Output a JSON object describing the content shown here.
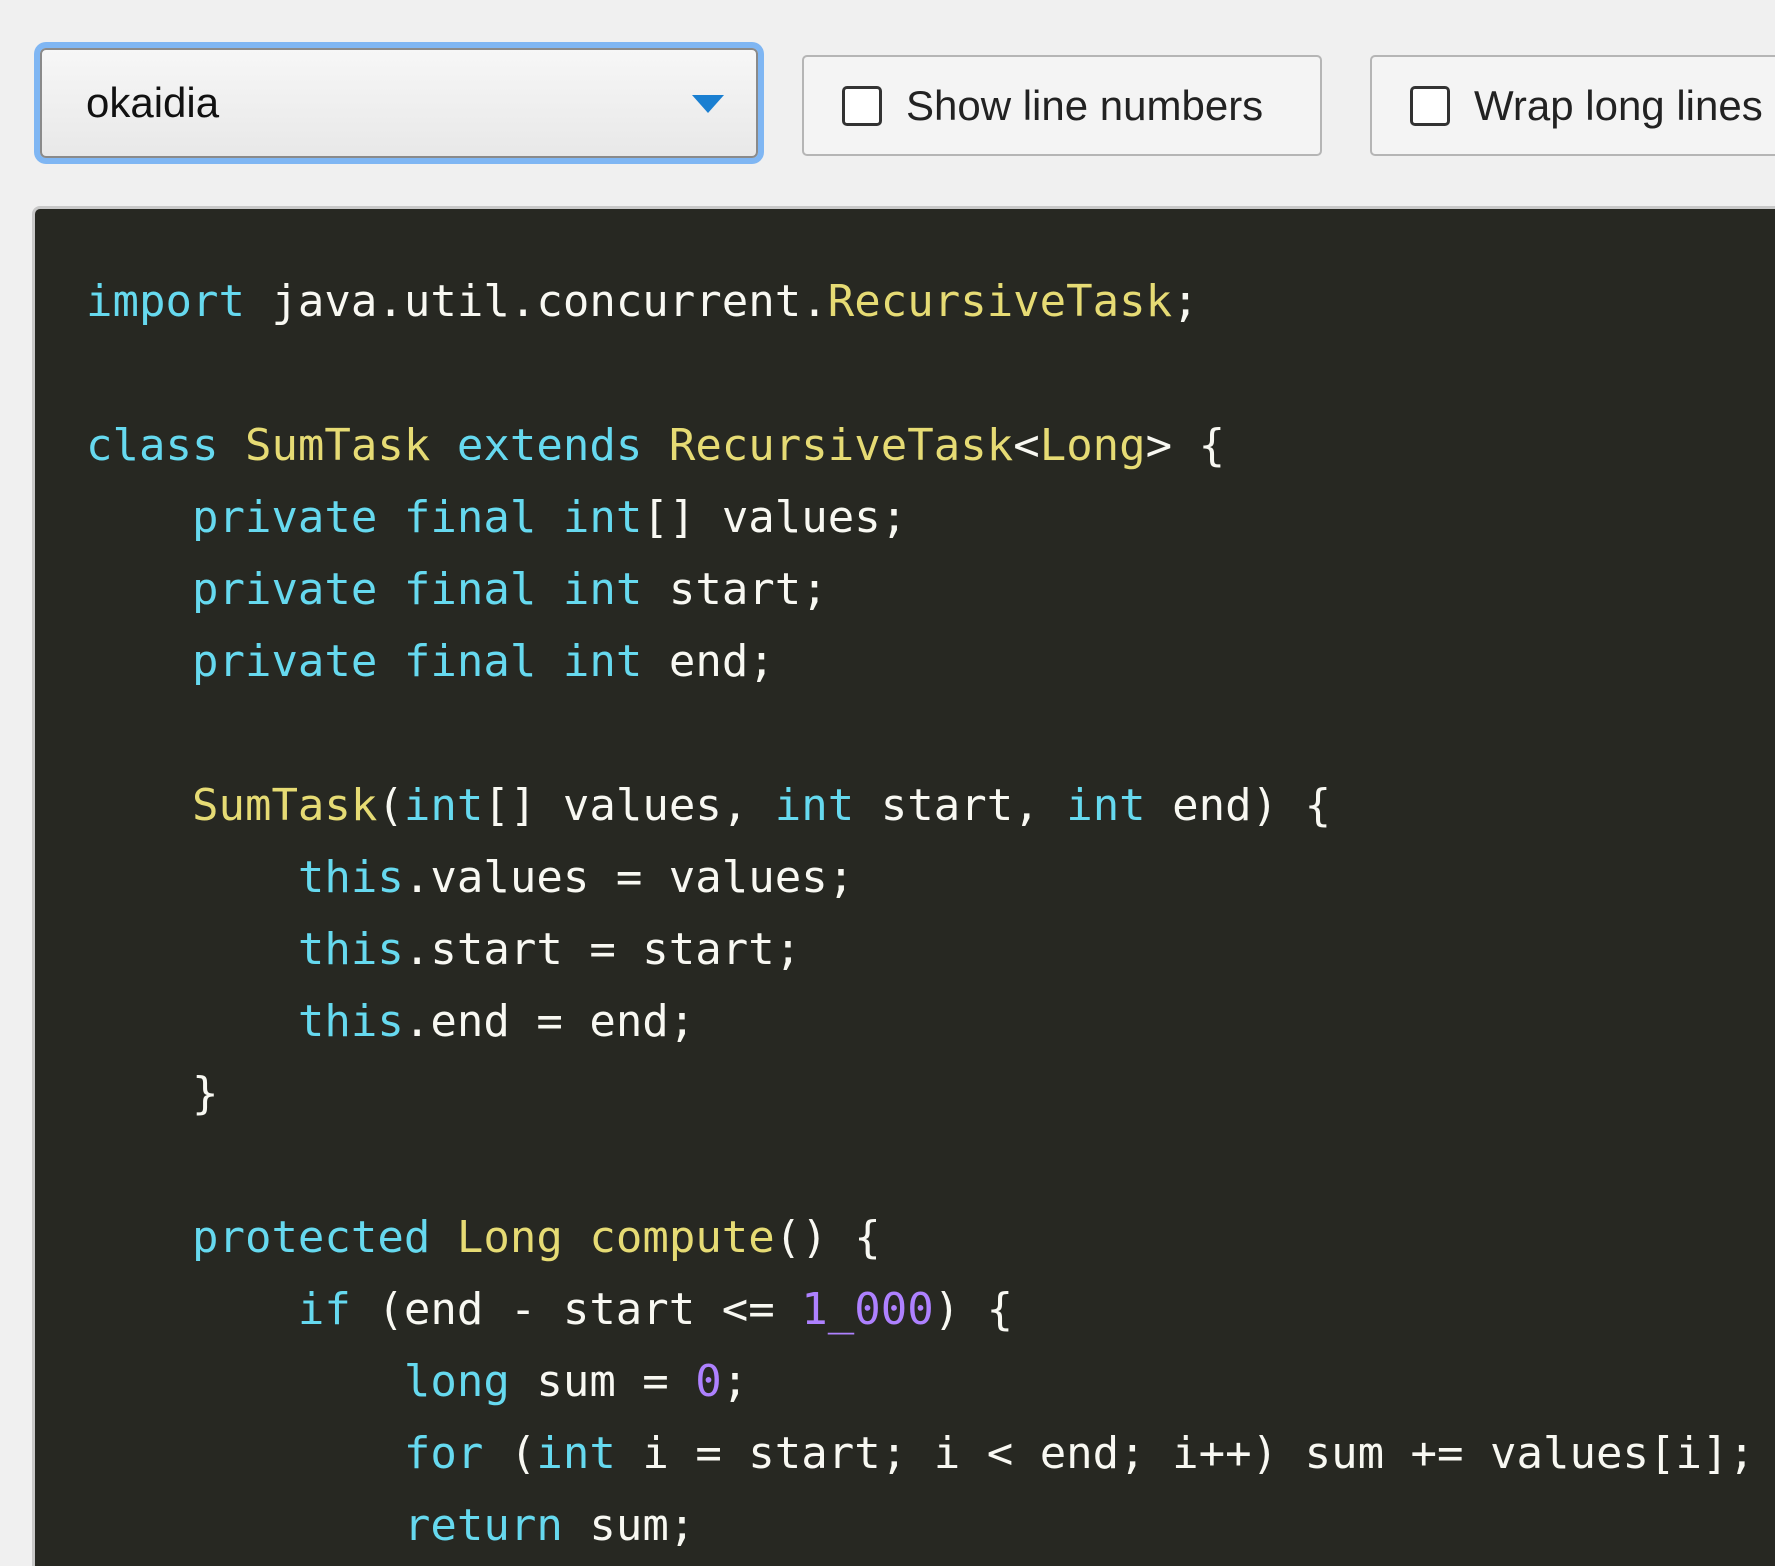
{
  "toolbar": {
    "theme_select": {
      "value": "okaidia"
    },
    "show_line_numbers": {
      "label": "Show line numbers",
      "checked": false
    },
    "wrap_long_lines": {
      "label": "Wrap long lines",
      "checked": false
    }
  },
  "colors": {
    "code_background": "#272822",
    "keyword": "#66d9ef",
    "type_function": "#e6db74",
    "number": "#ae81ff",
    "plain": "#f8f8f2",
    "focus_ring": "#7fb6f3",
    "select_arrow": "#1a7fd1"
  },
  "icons": {
    "select_arrow": "chevron-down-icon",
    "checkbox": "checkbox-unchecked-icon"
  },
  "code": {
    "language": "java",
    "lines": [
      [
        [
          "kw",
          "import"
        ],
        [
          "pl",
          " java.util.concurrent."
        ],
        [
          "ty",
          "RecursiveTask"
        ],
        [
          "pl",
          ";"
        ]
      ],
      [],
      [
        [
          "kw",
          "class"
        ],
        [
          "pl",
          " "
        ],
        [
          "ty",
          "SumTask"
        ],
        [
          "pl",
          " "
        ],
        [
          "kw",
          "extends"
        ],
        [
          "pl",
          " "
        ],
        [
          "ty",
          "RecursiveTask"
        ],
        [
          "pl",
          "<"
        ],
        [
          "ty",
          "Long"
        ],
        [
          "pl",
          "> {"
        ]
      ],
      [
        [
          "pl",
          "    "
        ],
        [
          "kw",
          "private"
        ],
        [
          "pl",
          " "
        ],
        [
          "kw",
          "final"
        ],
        [
          "pl",
          " "
        ],
        [
          "kw",
          "int"
        ],
        [
          "pl",
          "[] values;"
        ]
      ],
      [
        [
          "pl",
          "    "
        ],
        [
          "kw",
          "private"
        ],
        [
          "pl",
          " "
        ],
        [
          "kw",
          "final"
        ],
        [
          "pl",
          " "
        ],
        [
          "kw",
          "int"
        ],
        [
          "pl",
          " start;"
        ]
      ],
      [
        [
          "pl",
          "    "
        ],
        [
          "kw",
          "private"
        ],
        [
          "pl",
          " "
        ],
        [
          "kw",
          "final"
        ],
        [
          "pl",
          " "
        ],
        [
          "kw",
          "int"
        ],
        [
          "pl",
          " end;"
        ]
      ],
      [],
      [
        [
          "pl",
          "    "
        ],
        [
          "fn",
          "SumTask"
        ],
        [
          "pl",
          "("
        ],
        [
          "kw",
          "int"
        ],
        [
          "pl",
          "[] values, "
        ],
        [
          "kw",
          "int"
        ],
        [
          "pl",
          " start, "
        ],
        [
          "kw",
          "int"
        ],
        [
          "pl",
          " end) {"
        ]
      ],
      [
        [
          "pl",
          "        "
        ],
        [
          "kw",
          "this"
        ],
        [
          "pl",
          ".values = values;"
        ]
      ],
      [
        [
          "pl",
          "        "
        ],
        [
          "kw",
          "this"
        ],
        [
          "pl",
          ".start = start;"
        ]
      ],
      [
        [
          "pl",
          "        "
        ],
        [
          "kw",
          "this"
        ],
        [
          "pl",
          ".end = end;"
        ]
      ],
      [
        [
          "pl",
          "    }"
        ]
      ],
      [],
      [
        [
          "pl",
          "    "
        ],
        [
          "kw",
          "protected"
        ],
        [
          "pl",
          " "
        ],
        [
          "ty",
          "Long"
        ],
        [
          "pl",
          " "
        ],
        [
          "fn",
          "compute"
        ],
        [
          "pl",
          "() {"
        ]
      ],
      [
        [
          "pl",
          "        "
        ],
        [
          "kw",
          "if"
        ],
        [
          "pl",
          " (end - start <= "
        ],
        [
          "nu",
          "1_000"
        ],
        [
          "pl",
          ") {"
        ]
      ],
      [
        [
          "pl",
          "            "
        ],
        [
          "kw",
          "long"
        ],
        [
          "pl",
          " sum = "
        ],
        [
          "nu",
          "0"
        ],
        [
          "pl",
          ";"
        ]
      ],
      [
        [
          "pl",
          "            "
        ],
        [
          "kw",
          "for"
        ],
        [
          "pl",
          " ("
        ],
        [
          "kw",
          "int"
        ],
        [
          "pl",
          " i = start; i < end; i++) sum += values[i];"
        ]
      ],
      [
        [
          "pl",
          "            "
        ],
        [
          "kw",
          "return"
        ],
        [
          "pl",
          " sum;"
        ]
      ]
    ]
  }
}
